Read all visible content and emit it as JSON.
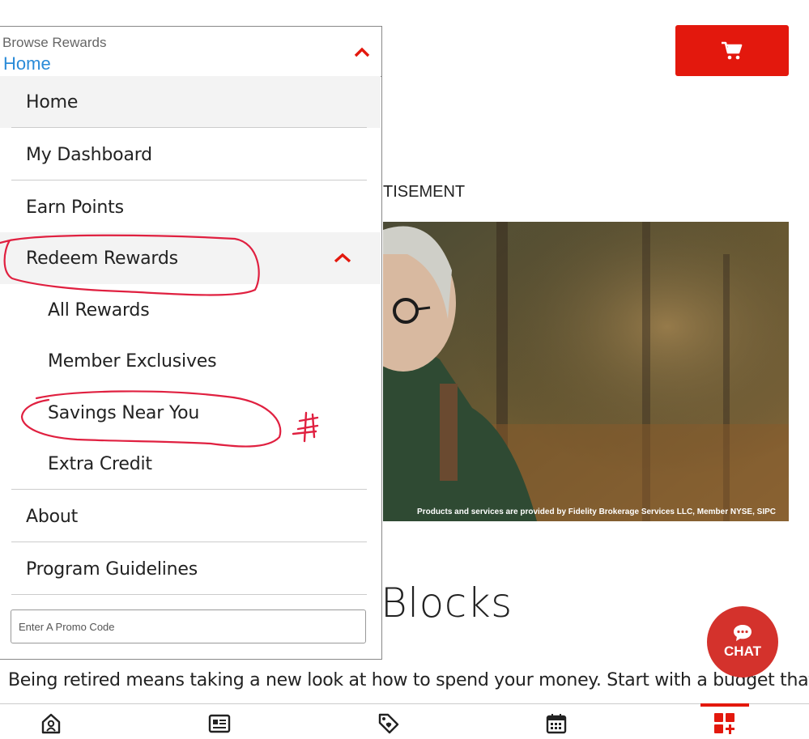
{
  "dropdown": {
    "caption": "Browse Rewards",
    "selected": "Home",
    "items": [
      {
        "label": "Home"
      },
      {
        "label": "My Dashboard"
      },
      {
        "label": "Earn Points"
      },
      {
        "label": "Redeem Rewards",
        "expanded": true
      },
      {
        "label": "All Rewards"
      },
      {
        "label": "Member Exclusives"
      },
      {
        "label": "Savings Near You"
      },
      {
        "label": "Extra Credit"
      },
      {
        "label": "About"
      },
      {
        "label": "Program Guidelines"
      }
    ],
    "promo_placeholder": "Enter A Promo Code"
  },
  "page": {
    "ad_label": "TISEMENT",
    "ad_disclaimer": "Products and services are provided by Fidelity Brokerage Services LLC, Member NYSE, SIPC",
    "article_title": "Blocks",
    "article_body": "Being retired means taking a new look at how to spend your money. Start with a budget that"
  },
  "chat": {
    "label": "CHAT"
  },
  "icons": {
    "cart": "cart-icon",
    "chat": "chat-bubble-icon",
    "nav": [
      "home-icon",
      "profile-card-icon",
      "tag-icon",
      "calendar-icon",
      "apps-plus-icon"
    ]
  },
  "colors": {
    "brand_red": "#e3180d",
    "link_blue": "#2a8bd8",
    "chat_red": "#d4322c",
    "annotation_red": "#e02040"
  }
}
